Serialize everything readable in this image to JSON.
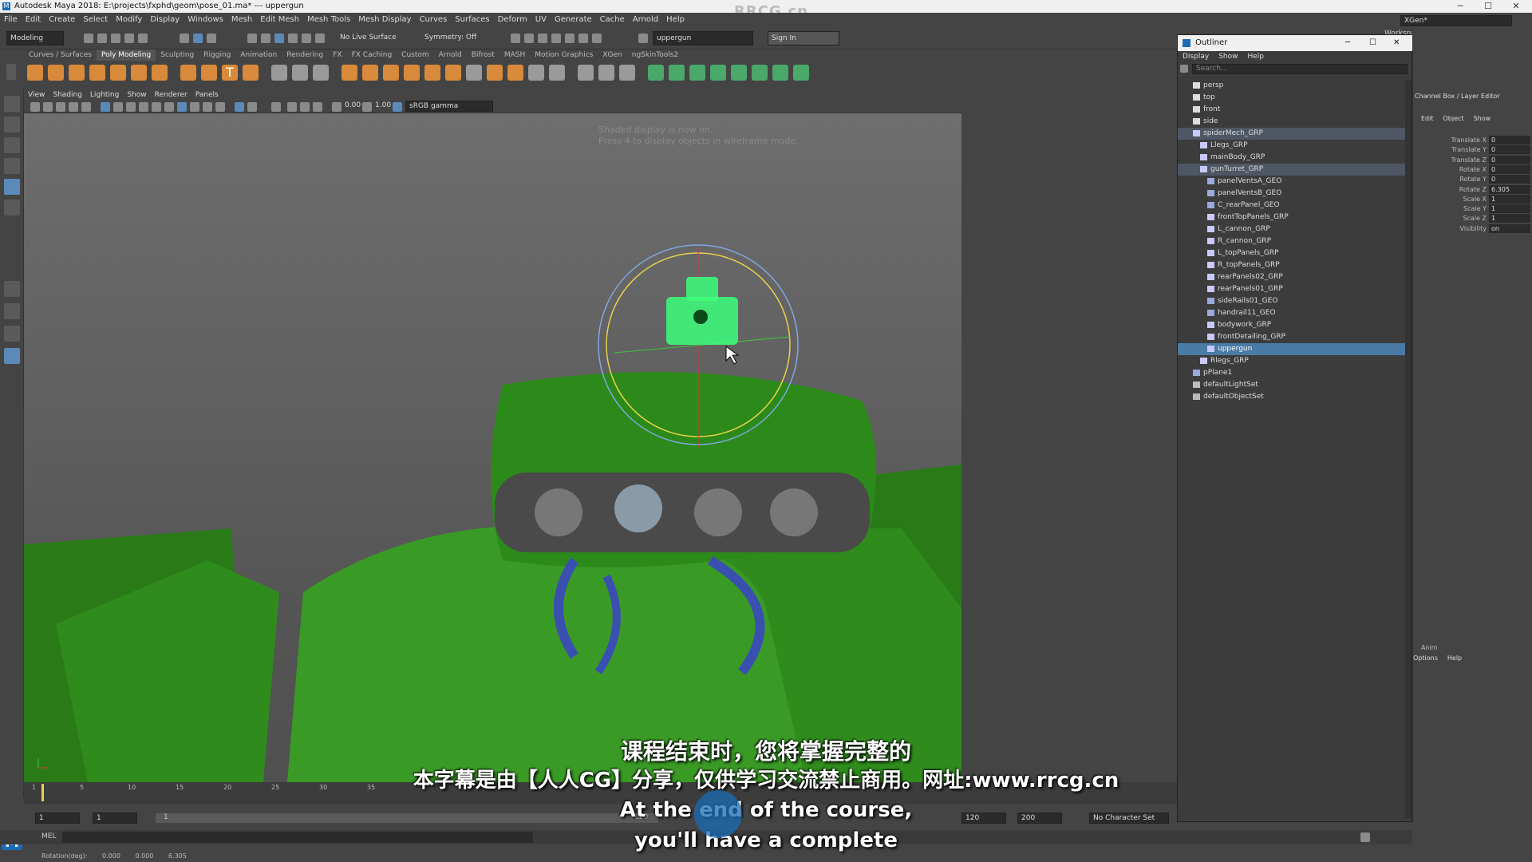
{
  "window": {
    "title": "Autodesk Maya 2018: E:\\projects\\fxphd\\geom\\pose_01.ma*  ---  uppergun",
    "watermark": "RRCG.cn"
  },
  "menubar": [
    "File",
    "Edit",
    "Create",
    "Select",
    "Modify",
    "Display",
    "Windows",
    "Mesh",
    "Edit Mesh",
    "Mesh Tools",
    "Mesh Display",
    "Curves",
    "Surfaces",
    "Deform",
    "UV",
    "Generate",
    "Cache",
    "Arnold",
    "Help"
  ],
  "toolbar": {
    "mode": "Modeling",
    "live_surface": "No Live Surface",
    "symmetry": "Symmetry: Off",
    "object_field": "uppergun",
    "sign_in": "Sign In",
    "workspace_label": "Workspace :",
    "workspace_value": "XGen*"
  },
  "shelf_tabs": [
    "Curves / Surfaces",
    "Poly Modeling",
    "Sculpting",
    "Rigging",
    "Animation",
    "Rendering",
    "FX",
    "FX Caching",
    "Custom",
    "Arnold",
    "Bifrost",
    "MASH",
    "Motion Graphics",
    "XGen",
    "ngSkinTools2"
  ],
  "shelf_active": "Poly Modeling",
  "viewport": {
    "menu": [
      "View",
      "Shading",
      "Lighting",
      "Show",
      "Renderer",
      "Panels"
    ],
    "exposure": "0.00",
    "gamma": "1.00",
    "color_space": "sRGB gamma",
    "message_line1": "Shaded display is now on.",
    "message_line2": "Press 4 to display objects in wireframe mode."
  },
  "outliner": {
    "title": "Outliner",
    "menu": [
      "Display",
      "Show",
      "Help"
    ],
    "search_placeholder": "Search...",
    "items": [
      {
        "label": "persp",
        "level": 1,
        "type": "camera"
      },
      {
        "label": "top",
        "level": 1,
        "type": "camera"
      },
      {
        "label": "front",
        "level": 1,
        "type": "camera"
      },
      {
        "label": "side",
        "level": 1,
        "type": "camera"
      },
      {
        "label": "spiderMech_GRP",
        "level": 1,
        "type": "group",
        "state": "highlight"
      },
      {
        "label": "Llegs_GRP",
        "level": 2,
        "type": "group"
      },
      {
        "label": "mainBody_GRP",
        "level": 2,
        "type": "group"
      },
      {
        "label": "gunTurret_GRP",
        "level": 2,
        "type": "group",
        "state": "highlight"
      },
      {
        "label": "panelVentsA_GEO",
        "level": 3,
        "type": "mesh"
      },
      {
        "label": "panelVentsB_GEO",
        "level": 3,
        "type": "mesh"
      },
      {
        "label": "C_rearPanel_GEO",
        "level": 3,
        "type": "mesh"
      },
      {
        "label": "frontTopPanels_GRP",
        "level": 3,
        "type": "group"
      },
      {
        "label": "L_cannon_GRP",
        "level": 3,
        "type": "group"
      },
      {
        "label": "R_cannon_GRP",
        "level": 3,
        "type": "group"
      },
      {
        "label": "L_topPanels_GRP",
        "level": 3,
        "type": "group"
      },
      {
        "label": "R_topPanels_GRP",
        "level": 3,
        "type": "group"
      },
      {
        "label": "rearPanels02_GRP",
        "level": 3,
        "type": "group"
      },
      {
        "label": "rearPanels01_GRP",
        "level": 3,
        "type": "group"
      },
      {
        "label": "sideRails01_GEO",
        "level": 3,
        "type": "mesh"
      },
      {
        "label": "handrail11_GEO",
        "level": 3,
        "type": "mesh"
      },
      {
        "label": "bodywork_GRP",
        "level": 3,
        "type": "group"
      },
      {
        "label": "frontDetailing_GRP",
        "level": 3,
        "type": "group"
      },
      {
        "label": "uppergun",
        "level": 3,
        "type": "group",
        "state": "selected"
      },
      {
        "label": "Rlegs_GRP",
        "level": 2,
        "type": "group"
      },
      {
        "label": "pPlane1",
        "level": 1,
        "type": "mesh"
      },
      {
        "label": "defaultLightSet",
        "level": 1,
        "type": "set"
      },
      {
        "label": "defaultObjectSet",
        "level": 1,
        "type": "set"
      }
    ]
  },
  "channel_box": {
    "title": "Channel Box / Layer Editor",
    "menu": [
      "Edit",
      "Object",
      "Show"
    ],
    "channels": [
      {
        "name": "Translate X",
        "value": "0"
      },
      {
        "name": "Translate Y",
        "value": "0"
      },
      {
        "name": "Translate Z",
        "value": "0"
      },
      {
        "name": "Rotate X",
        "value": "0"
      },
      {
        "name": "Rotate Y",
        "value": "0"
      },
      {
        "name": "Rotate Z",
        "value": "6.305"
      },
      {
        "name": "Scale X",
        "value": "1"
      },
      {
        "name": "Scale Y",
        "value": "1"
      },
      {
        "name": "Scale Z",
        "value": "1"
      },
      {
        "name": "Visibility",
        "value": "on"
      }
    ],
    "anim_label": "Anim",
    "anim_menu": [
      "Options",
      "Help"
    ]
  },
  "timeline": {
    "ticks": [
      "1",
      "5",
      "10",
      "15",
      "20",
      "25",
      "30",
      "35"
    ],
    "range_start": "1",
    "range_start2": "1",
    "range_inner": "1",
    "range_end_inner": "120",
    "range_end": "120",
    "range_max": "200",
    "character_set": "No Character Set"
  },
  "command_line": {
    "label": "MEL"
  },
  "help_line": {
    "label": "Rotation(deg):",
    "x": "0.000",
    "y": "0.000",
    "z": "6.305"
  },
  "subtitles": {
    "cn_line": "课程结束时，您将掌握完整的",
    "cn_notice": "本字幕是由【人人CG】分享，仅供学习交流禁止商用。网址:www.rrcg.cn",
    "en_line1": "At the end of the course,",
    "en_line2": "you'll have a complete"
  },
  "colors": {
    "accent_select": "#4a7aa6",
    "mech_green": "#2e8b1e",
    "turret_green": "#3cff7a",
    "manipulator_yellow": "#e6d24a",
    "manipulator_blue": "#7fa8e0"
  }
}
